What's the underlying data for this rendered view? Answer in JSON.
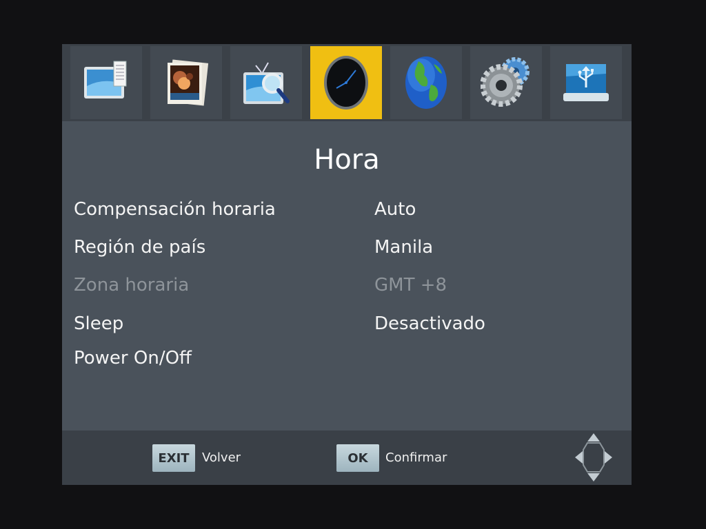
{
  "tabs": [
    {
      "name": "picture-icon",
      "active": false
    },
    {
      "name": "image-settings-icon",
      "active": false
    },
    {
      "name": "channel-search-icon",
      "active": false
    },
    {
      "name": "clock-icon",
      "active": true
    },
    {
      "name": "globe-icon",
      "active": false
    },
    {
      "name": "gears-icon",
      "active": false
    },
    {
      "name": "usb-icon",
      "active": false
    }
  ],
  "title": "Hora",
  "settings": [
    {
      "label": "Compensación horaria",
      "value": "Auto",
      "disabled": false
    },
    {
      "label": "Región de país",
      "value": "Manila",
      "disabled": false
    },
    {
      "label": "Zona horaria",
      "value": "GMT +8",
      "disabled": true
    },
    {
      "label": "Sleep",
      "value": "Desactivado",
      "disabled": false
    },
    {
      "label": "Power On/Off",
      "value": "",
      "disabled": false
    }
  ],
  "footer": {
    "exit_key": "EXIT",
    "exit_label": "Volver",
    "ok_key": "OK",
    "ok_label": "Confirmar"
  },
  "colors": {
    "active_tab": "#f0bf12",
    "panel": "#4a525b",
    "disabled_text": "#8e949a"
  }
}
